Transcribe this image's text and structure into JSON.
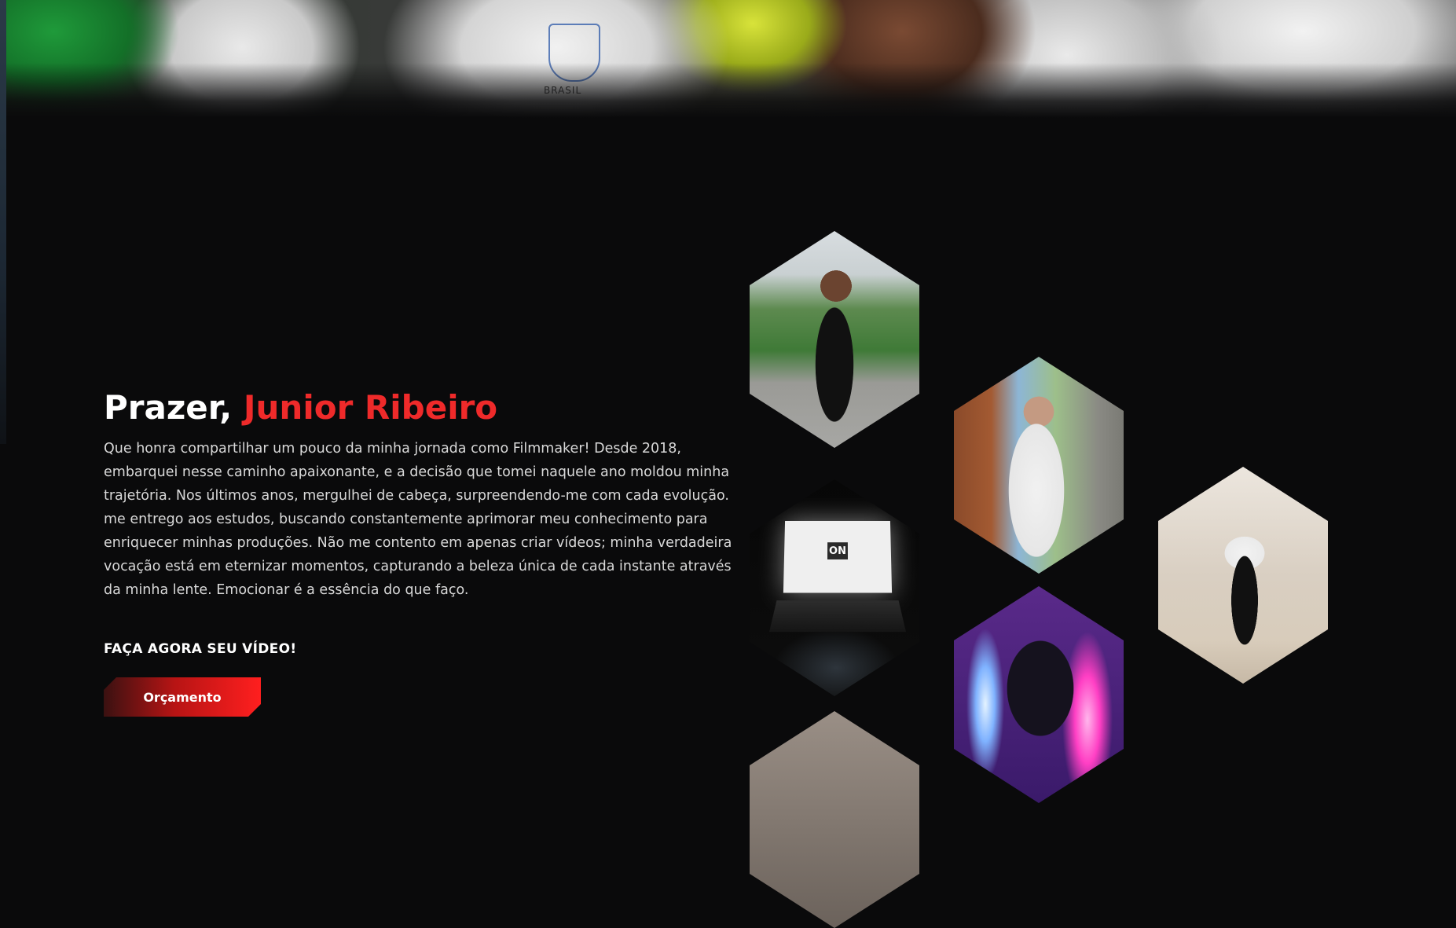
{
  "hero": {
    "emblem_text": "BRASIL"
  },
  "about": {
    "title_prefix": "Prazer, ",
    "title_name": "Junior Ribeiro",
    "description": "Que honra compartilhar um pouco da minha jornada como Filmmaker! Desde 2018, embarquei nesse caminho apaixonante, e a decisão que tomei naquele ano moldou minha trajetória. Nos últimos anos, mergulhei de cabeça, surpreendendo-me com cada evolução. me entrego aos estudos, buscando constantemente aprimorar meu conhecimento para enriquecer minhas produções. Não me contento em apenas criar vídeos; minha verdadeira vocação está em eternizar momentos, capturando a beleza única de cada instante através da minha lente. Emocionar é a essência do que faço.",
    "cta_label": "FAÇA AGORA SEU VÍDEO!",
    "cta_button": "Orçamento"
  },
  "gallery": {
    "laptop_logo": "ON"
  },
  "colors": {
    "background": "#0a0a0b",
    "accent": "#ef2a2a",
    "text": "#d9d9d9"
  }
}
